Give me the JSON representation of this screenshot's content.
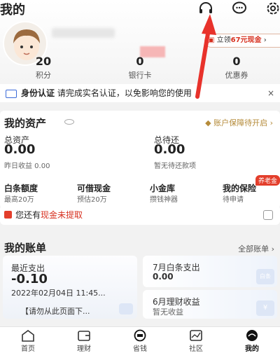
{
  "header": {
    "title": "我的",
    "icons": [
      "headset-icon",
      "message-icon",
      "settings-icon"
    ]
  },
  "promo": {
    "prefix": "立领",
    "amount": "67元现金",
    "chevron": "›"
  },
  "stats": [
    {
      "value": "20",
      "label": "积分"
    },
    {
      "value": "0",
      "label": "银行卡"
    },
    {
      "value": "0",
      "label": "优惠券"
    }
  ],
  "auth_bar": {
    "title": "身份认证",
    "text": "请完成实名认证，以免影响您的使用",
    "close": "×"
  },
  "assets": {
    "title": "我的资产",
    "guard": "账户保障待开启 ›",
    "total_assets": {
      "label": "总资产",
      "value": "0.00",
      "sub": "昨日收益 0.00"
    },
    "total_repay": {
      "label": "总待还",
      "value": "0.00",
      "sub": "暂无待还款项"
    },
    "quick": [
      {
        "title": "白条额度",
        "sub": "最高20万"
      },
      {
        "title": "可借现金",
        "sub": "预估20万"
      },
      {
        "title": "小金库",
        "sub": "攒钱神器"
      },
      {
        "title": "我的保险",
        "sub": "待申请"
      }
    ],
    "badge": "养老金"
  },
  "cash_notice": {
    "prefix": "您还有",
    "highlight": "现金未提取"
  },
  "bills": {
    "title": "我的账单",
    "all": "全部账单 ›",
    "recent": {
      "label": "最近支出",
      "value": "-0.10",
      "date": "2022年02月04日 11:45...",
      "note": "【请勿从此页面下..."
    },
    "july": {
      "label": "7月白条支出",
      "value": "0.00",
      "watermark": "白条"
    },
    "june": {
      "label": "6月理财收益",
      "value": "暂无收益",
      "watermark": "¥"
    }
  },
  "tabs": [
    {
      "label": "首页",
      "icon": "home-icon"
    },
    {
      "label": "理财",
      "icon": "wallet-icon"
    },
    {
      "label": "省钱",
      "icon": "save-money-icon"
    },
    {
      "label": "社区",
      "icon": "community-icon"
    },
    {
      "label": "我的",
      "icon": "profile-icon"
    }
  ],
  "active_tab": "我的",
  "colors": {
    "accent_red": "#d7301f",
    "gold": "#b58b3a",
    "annotation_arrow": "#e8322b"
  }
}
